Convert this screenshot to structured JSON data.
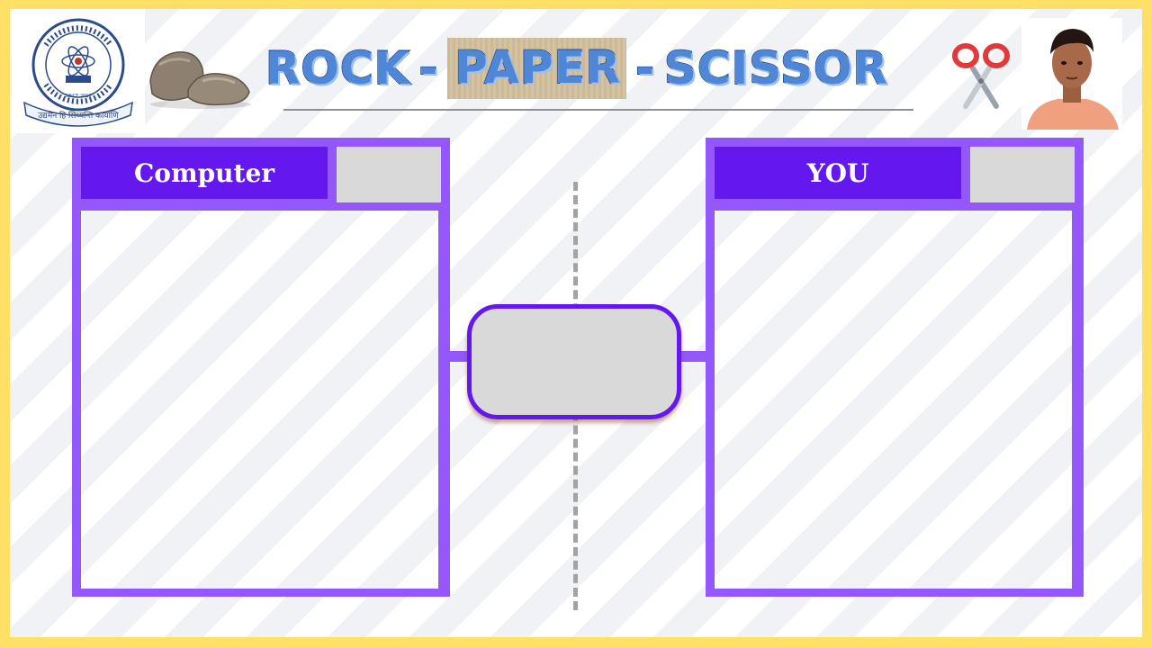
{
  "header": {
    "title_part1": "ROCK",
    "title_dash1": "-",
    "title_part2": "PAPER",
    "title_dash2": "-",
    "title_part3": "SCISSOR",
    "logo_motto": "उद्यमेन हि सिध्यन्ति कार्याणि",
    "logo_est": "SINCE 2018",
    "icons": {
      "rock": "rock-stones-icon",
      "scissor": "scissor-icon"
    }
  },
  "computer_panel": {
    "label": "Computer",
    "score": ""
  },
  "player_panel": {
    "label": "YOU",
    "score": ""
  },
  "result": {
    "text": ""
  },
  "colors": {
    "frame": "#ffe066",
    "panel": "#9457fb",
    "label_bg": "#6418ee",
    "score_bg": "#d9d9d9",
    "title_fill": "#4f86d6",
    "title_outline": "#1d4e9e"
  }
}
